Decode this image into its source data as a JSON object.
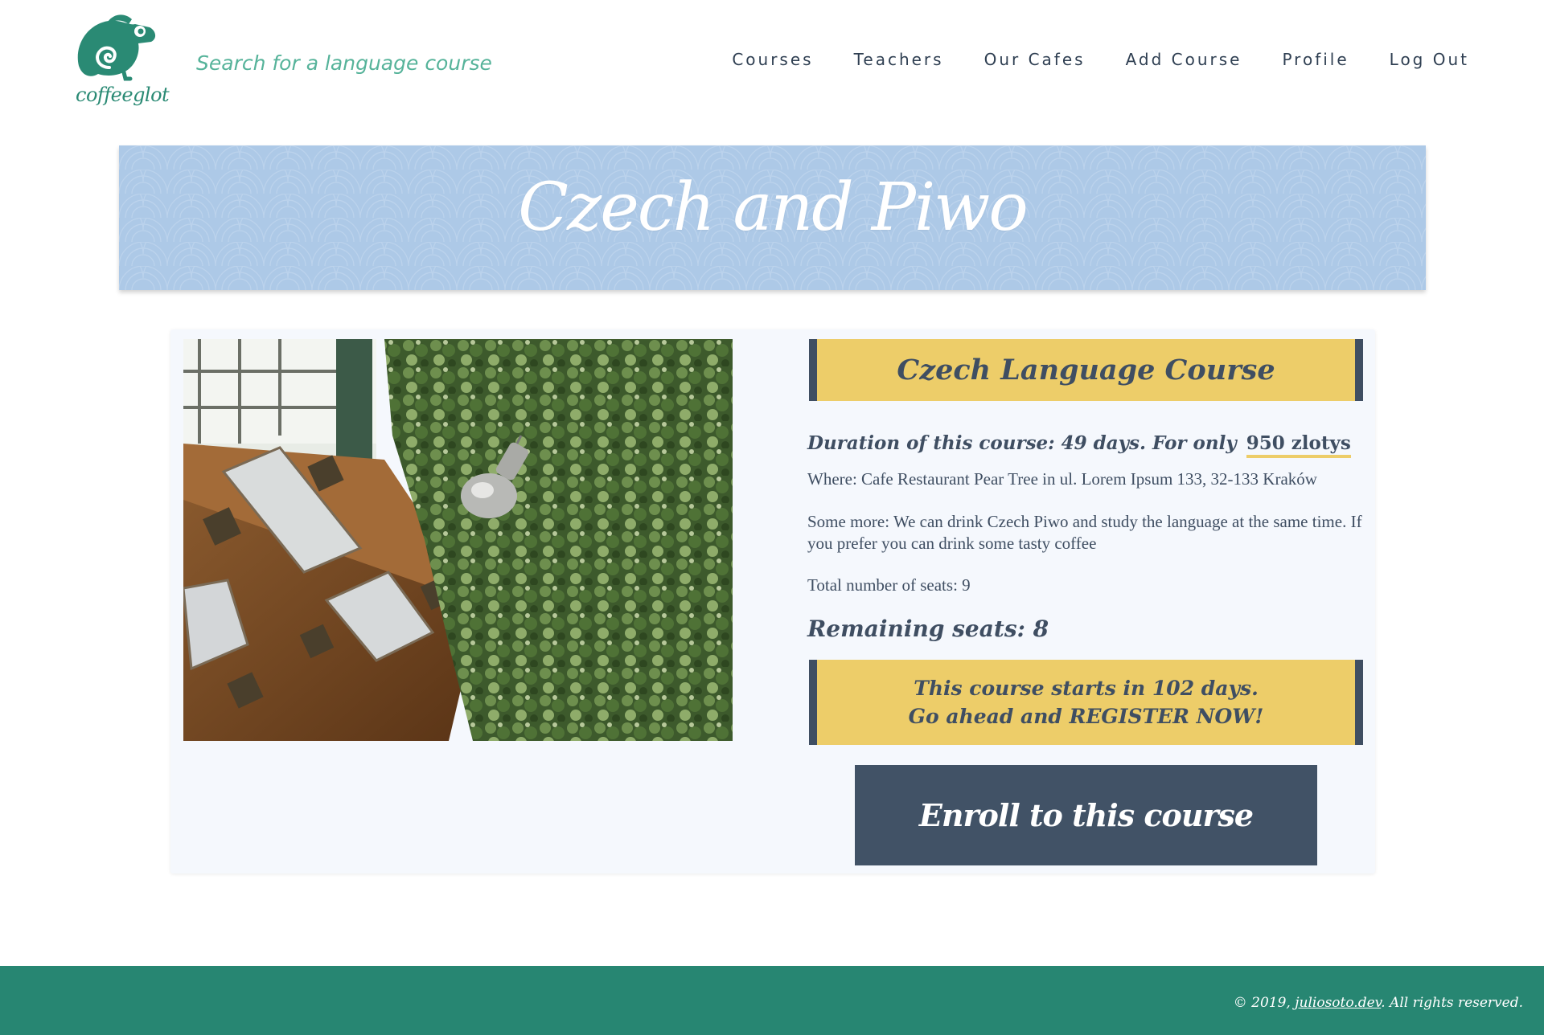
{
  "header": {
    "logo_text": "coffeeglot",
    "search_placeholder": "Search for a language course",
    "nav": [
      "Courses",
      "Teachers",
      "Our Cafes",
      "Add Course",
      "Profile",
      "Log Out"
    ]
  },
  "banner": {
    "title": "Czech and Piwo"
  },
  "course": {
    "title": "Czech Language Course",
    "duration_text": "Duration of this course: 49 days. For only",
    "price": "950 zlotys",
    "where": "Where: Cafe Restaurant Pear Tree in ul. Lorem Ipsum 133, 32-133 Kraków",
    "more": "Some more: We can drink Czech Piwo and study the language at the same time. If you prefer you can drink some tasty coffee",
    "seats": "Total number of seats: 9",
    "remaining": "Remaining seats: 8",
    "starts_line1": "This course starts in 102 days.",
    "starts_line2": "Go ahead and REGISTER NOW!",
    "enroll_label": "Enroll to this course"
  },
  "footer": {
    "prefix": "© 2019,",
    "link": "juliosoto.dev",
    "suffix": ". All rights reserved."
  },
  "colors": {
    "brand_green": "#278672",
    "banner_blue": "#adc9e7",
    "accent_yellow": "#edcd69",
    "dark_slate": "#415266"
  }
}
